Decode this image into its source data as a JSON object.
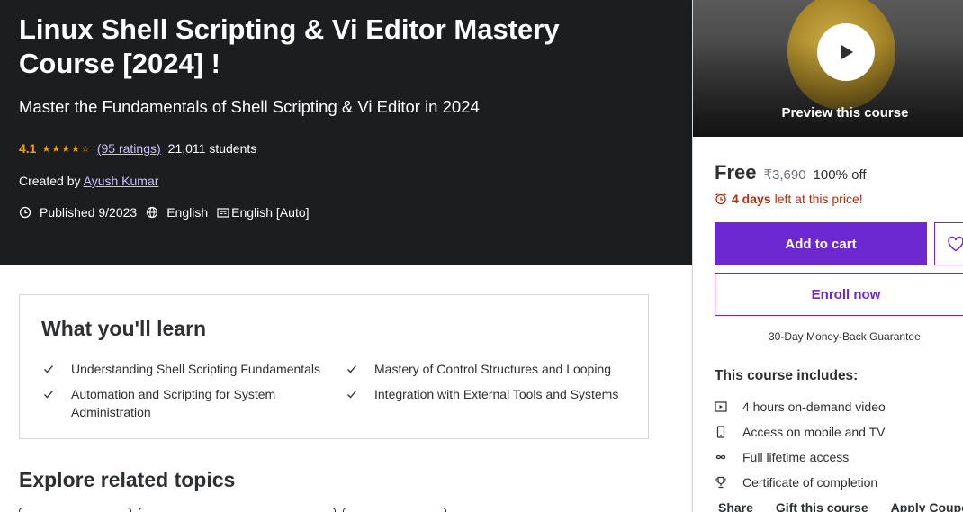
{
  "course": {
    "title": "Linux Shell Scripting & Vi Editor Mastery Course [2024] !",
    "subtitle": "Master the Fundamentals of Shell Scripting & Vi Editor in 2024",
    "rating": "4.1",
    "rating_stars": 4.1,
    "ratings_link": "(95 ratings)",
    "students": "21,011 students",
    "created_by_label": "Created by",
    "author": "Ayush Kumar",
    "published": "Published 9/2023",
    "language": "English",
    "captions": "English [Auto]"
  },
  "learn": {
    "title": "What you'll learn",
    "items": [
      "Understanding Shell Scripting Fundamentals",
      "Mastery of Control Structures and Looping",
      "Automation and Scripting for System Administration",
      "Integration with External Tools and Systems"
    ]
  },
  "explore": {
    "title": "Explore related topics"
  },
  "sidebar": {
    "preview_label": "Preview this course",
    "price_free": "Free",
    "price_original": "₹3,690",
    "discount": "100% off",
    "deadline_bold": "4 days",
    "deadline_rest": "left at this price!",
    "add_to_cart": "Add to cart",
    "enroll_now": "Enroll now",
    "guarantee": "30-Day Money-Back Guarantee",
    "includes_title": "This course includes:",
    "includes": [
      {
        "icon": "video-icon",
        "label": "4 hours on-demand video"
      },
      {
        "icon": "mobile-icon",
        "label": "Access on mobile and TV"
      },
      {
        "icon": "infinity-icon",
        "label": "Full lifetime access"
      },
      {
        "icon": "trophy-icon",
        "label": "Certificate of completion"
      }
    ],
    "share": "Share",
    "gift": "Gift this course",
    "coupon": "Apply Coupon"
  },
  "colors": {
    "hero_bg": "#1c1d1f",
    "accent": "#6d28d2",
    "rating": "#f69c08",
    "link": "#cec0fc",
    "alert": "#b32d0f"
  }
}
